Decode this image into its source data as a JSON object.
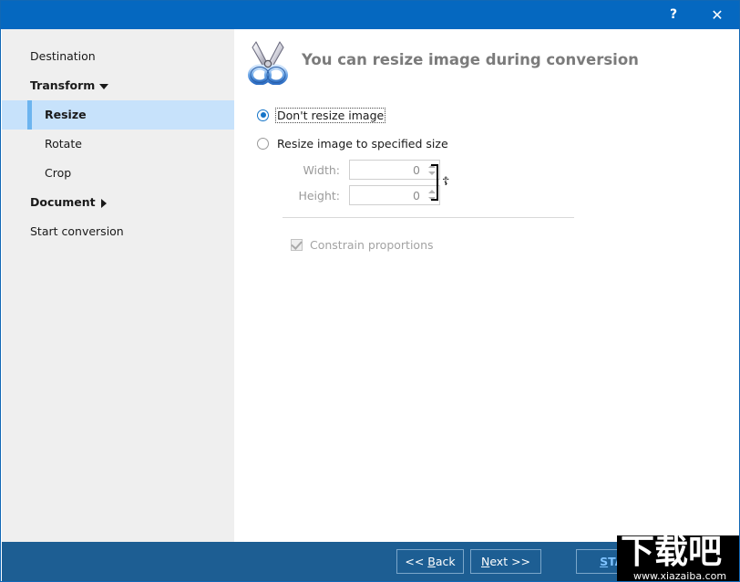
{
  "window": {
    "title": "",
    "help_label": "?",
    "close_label": "✕"
  },
  "sidebar": {
    "items": [
      {
        "label": "Destination",
        "type": "item",
        "selected": false
      },
      {
        "label": "Transform",
        "type": "group",
        "expanded": true,
        "selected": false
      },
      {
        "label": "Resize",
        "type": "child",
        "selected": true
      },
      {
        "label": "Rotate",
        "type": "child",
        "selected": false
      },
      {
        "label": "Crop",
        "type": "child",
        "selected": false
      },
      {
        "label": "Document",
        "type": "group",
        "expanded": false,
        "selected": false
      },
      {
        "label": "Start conversion",
        "type": "item",
        "selected": false
      }
    ]
  },
  "main": {
    "header": {
      "icon": "scissors-icon",
      "title": "You can resize image during conversion"
    },
    "resize_mode": {
      "option_none": "Don't resize image",
      "option_specified": "Resize image to specified size",
      "selected": "option_none"
    },
    "fields": {
      "width_label": "Width:",
      "width_value": "0",
      "height_label": "Height:",
      "height_value": "0",
      "link_icon": "chain-link-icon"
    },
    "constrain": {
      "label": "Constrain proportions",
      "checked": true,
      "enabled": false
    }
  },
  "footer": {
    "back_label_pre": "<< ",
    "back_label_key": "B",
    "back_label_post": "ack",
    "next_label_key": "N",
    "next_label_post": "ext >>",
    "start_label_key": "S",
    "start_label_post": "TART"
  },
  "watermark": {
    "text_cn": "下载吧",
    "url": "www.xiazaiba.com"
  },
  "colors": {
    "titlebar": "#0568c0",
    "footer": "#1d5e93",
    "sidebar_bg": "#efefef",
    "selected_bg": "#c7e2fb",
    "accent_bar": "#6cb4ef",
    "radio_accent": "#1574c8",
    "header_text": "#7b7b7b",
    "start_text": "#7fc3ff"
  }
}
